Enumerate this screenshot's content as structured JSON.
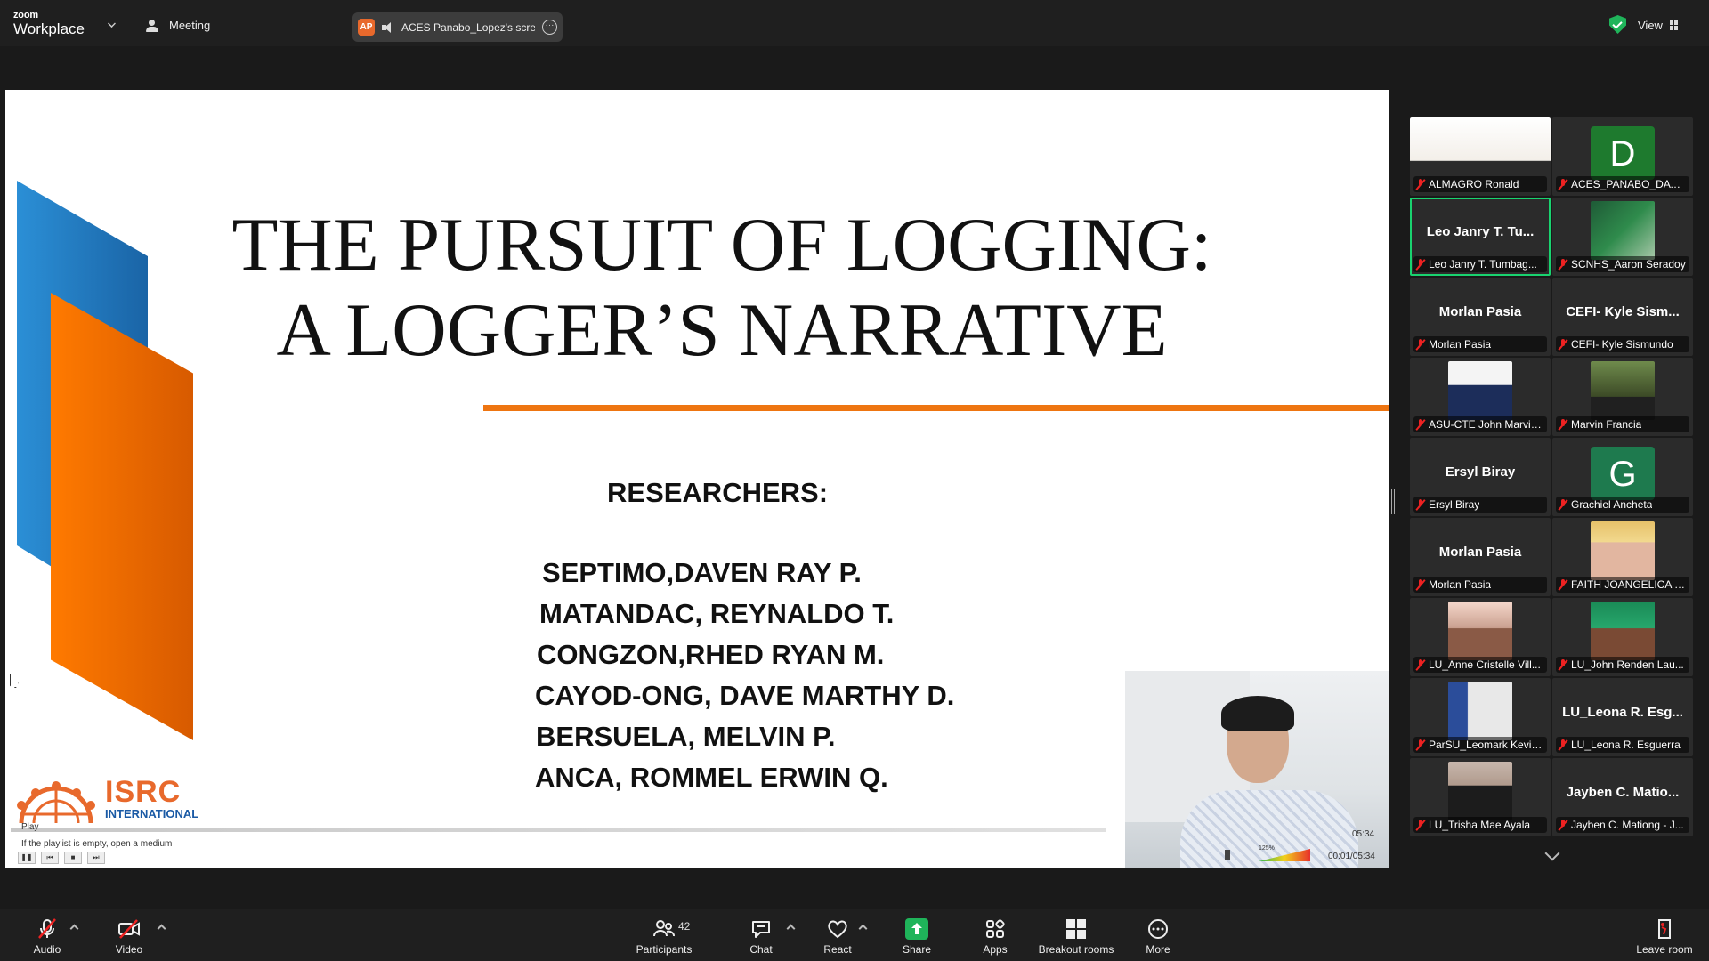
{
  "topbar": {
    "brand_top": "zoom",
    "brand_bottom": "Workplace",
    "meeting_label": "Meeting",
    "share_initials": "AP",
    "share_label": "ACES Panabo_Lopez's screen",
    "view_label": "View"
  },
  "slide": {
    "title_line1": "THE PURSUIT OF LOGGING:",
    "title_line2": "A LOGGER’S NARRATIVE",
    "researchers_heading": "RESEARCHERS:",
    "researchers": [
      "SEPTIMO,DAVEN RAY P.",
      "MATANDAC, REYNALDO T.",
      "CONGZON,RHED RYAN M.",
      "CAYOD-ONG, DAVE MARTHY D.",
      "BERSUELA, MELVIN P.",
      "ANCA, ROMMEL ERWIN Q."
    ],
    "logo_name": "ISRC",
    "logo_sub": "INTERNATIONAL",
    "accent_orange": "#ee7511",
    "accent_blue": "#1a64a6"
  },
  "player": {
    "play_label": "Play",
    "hint": "If the playlist is empty, open a medium",
    "duration": "05:34",
    "position": "00:01/05:34",
    "volume": "125%"
  },
  "gallery": [
    {
      "display": "",
      "name": "ALMAGRO Ronald",
      "kind": "photo"
    },
    {
      "display": "D",
      "name": "ACES_PANABO_DAVE...",
      "kind": "letter",
      "color": "#1e7a2e"
    },
    {
      "display": "Leo Janry T. Tu...",
      "name": "Leo Janry T. Tumbag...",
      "kind": "name",
      "active": true
    },
    {
      "display": "",
      "name": "SCNHS_Aaron Seradoy",
      "kind": "photo"
    },
    {
      "display": "Morlan Pasia",
      "name": "Morlan Pasia",
      "kind": "name"
    },
    {
      "display": "CEFI- Kyle Sism...",
      "name": "CEFI- Kyle Sismundo",
      "kind": "name"
    },
    {
      "display": "",
      "name": "ASU-CTE John Marvin...",
      "kind": "photo"
    },
    {
      "display": "",
      "name": "Marvin Francia",
      "kind": "photo"
    },
    {
      "display": "Ersyl Biray",
      "name": "Ersyl Biray",
      "kind": "name"
    },
    {
      "display": "G",
      "name": "Grachiel Ancheta",
      "kind": "letter",
      "color": "#1e7a4e"
    },
    {
      "display": "Morlan Pasia",
      "name": "Morlan Pasia",
      "kind": "name"
    },
    {
      "display": "",
      "name": "FAITH JOANGELICA E...",
      "kind": "photo"
    },
    {
      "display": "",
      "name": "LU_Anne Cristelle Vill...",
      "kind": "photo"
    },
    {
      "display": "",
      "name": "LU_John Renden Lau...",
      "kind": "photo"
    },
    {
      "display": "",
      "name": "ParSU_Leomark Kevin...",
      "kind": "photo"
    },
    {
      "display": "LU_Leona R. Esg...",
      "name": "LU_Leona R. Esguerra",
      "kind": "name"
    },
    {
      "display": "",
      "name": "LU_Trisha Mae Ayala",
      "kind": "photo"
    },
    {
      "display": "Jayben C. Matio...",
      "name": "Jayben C. Mationg - J...",
      "kind": "name"
    }
  ],
  "toolbar": {
    "audio": "Audio",
    "video": "Video",
    "participants": "Participants",
    "participants_count": "42",
    "chat": "Chat",
    "react": "React",
    "share": "Share",
    "apps": "Apps",
    "breakout": "Breakout rooms",
    "more": "More",
    "leave": "Leave room"
  }
}
